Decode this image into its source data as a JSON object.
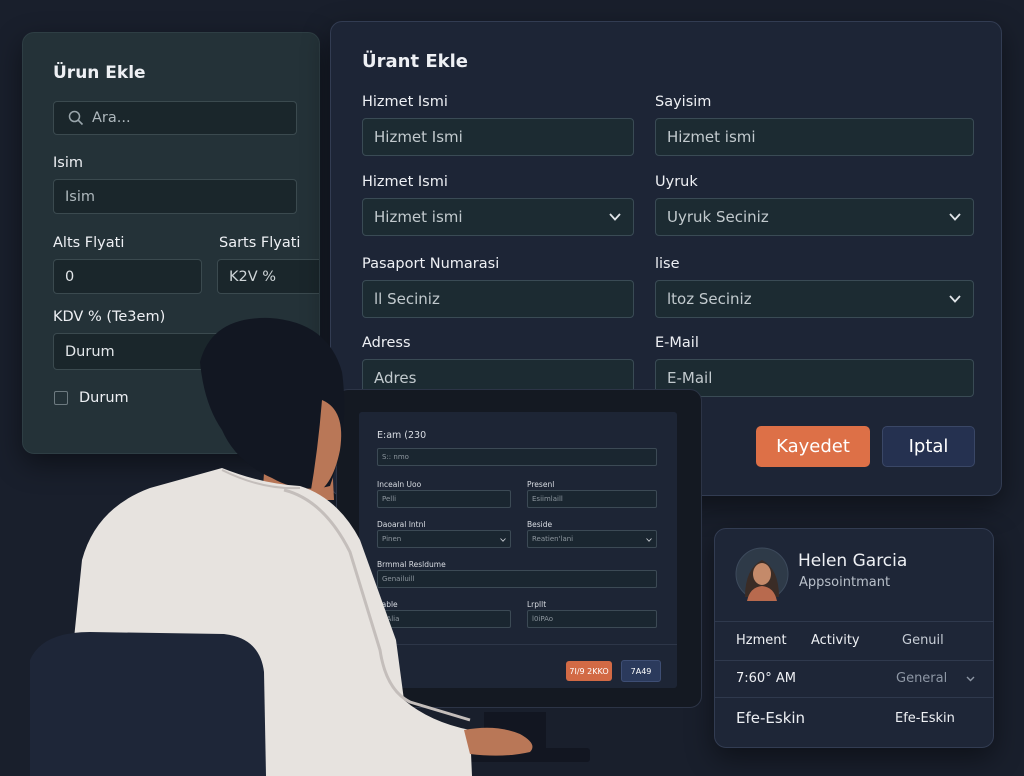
{
  "left_panel": {
    "title": "Ürun Ekle",
    "search_placeholder": "Ara...",
    "name_label": "Isim",
    "name_placeholder": "Isim",
    "buy_price_label": "Alts Flyati",
    "buy_price_value": "0",
    "sell_price_label": "Sarts Flyati",
    "sell_price_value": "K2V %",
    "kdv_label": "KDV % (Te3em)",
    "status_value": "Durum",
    "status_checkbox_label": "Durum"
  },
  "main_form": {
    "title": "Ürant Ekle",
    "service_name_label": "Hizmet Ismi",
    "service_name_placeholder": "Hizmet Ismi",
    "surname_label": "Sayisim",
    "surname_placeholder": "Hizmet ismi",
    "service_name2_label": "Hizmet Ismi",
    "service_name2_value": "Hizmet ismi",
    "nationality_label": "Uyruk",
    "nationality_value": "Uyruk Seciniz",
    "passport_label": "Pasaport Numarasi",
    "passport_placeholder": "ll Seciniz",
    "district_label": "lise",
    "district_value": "ltoz Seciniz",
    "address_label": "Adress",
    "address_placeholder": "Adres",
    "email_label": "E-Mail",
    "email_placeholder": "E-Mail",
    "save_label": "Kayedet",
    "cancel_label": "Iptal"
  },
  "contact_card": {
    "name": "Helen Garcia",
    "subtitle": "Appsointmant",
    "columns": [
      "Hzment",
      "Activity",
      "Genuil"
    ],
    "time": "7:60° AM",
    "general_value": "General",
    "row_left": "Efe-Eskin",
    "row_right": "Efe-Eskin"
  },
  "monitor_screen": {
    "title": "E:am (230",
    "search_placeholder": "S:: nmo",
    "f1_label": "Incealn Uoo",
    "f1_value": "Pelli",
    "f2_label": "Presenl",
    "f2_value": "Esiimlaill",
    "f3_label": "Daoaral Intnl",
    "f3_value": "Pinen",
    "f4_label": "Beside",
    "f4_value": "Reatien'lani",
    "f5_label": "Brmmal Resldume",
    "f5_value": "Genailuill",
    "f6_label": "aable",
    "f6_value": "pAlia",
    "f7_label": "Lrpllt",
    "f7_value": "l0iPAo",
    "save_label": "7I/9 2KKO",
    "cancel_label": "7A49"
  },
  "colors": {
    "accent": "#dd7047",
    "secondary_button": "#253150",
    "background": "#191f2c"
  }
}
